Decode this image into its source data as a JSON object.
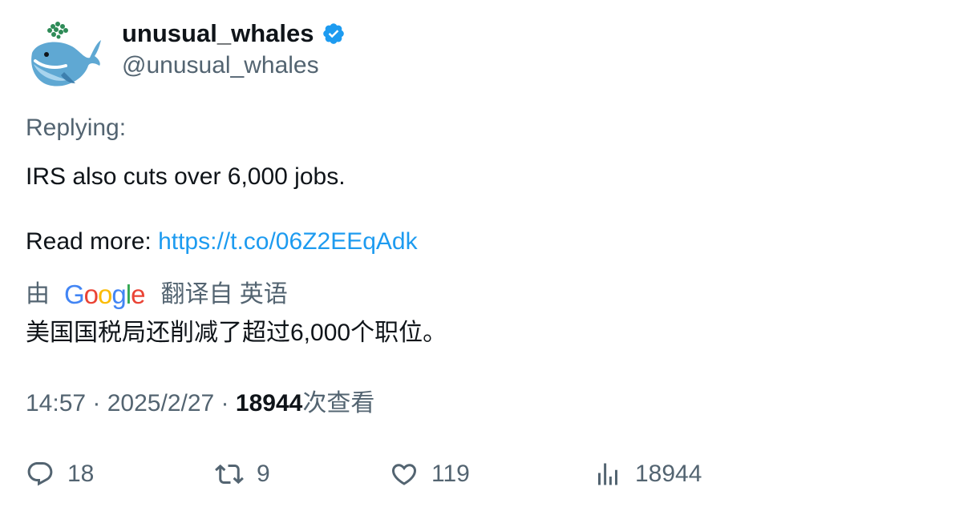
{
  "author": {
    "display_name": "unusual_whales",
    "handle": "@unusual_whales",
    "verified_icon": "verified-badge-icon",
    "avatar_icon": "whale-avatar-icon"
  },
  "tweet": {
    "replying_label": "Replying:",
    "line1": "IRS also cuts over 6,000 jobs.",
    "read_more_label": "Read more: ",
    "link_text": "https://t.co/06Z2EEqAdk"
  },
  "translation": {
    "by_label": "由",
    "provider": "Google",
    "from_label": "翻译自 英语",
    "translated_text": "美国国税局还削减了超过6,000个职位。"
  },
  "meta": {
    "time": "14:57",
    "separator": " · ",
    "date": "2025/2/27",
    "views_count": "18944",
    "views_label": "次查看"
  },
  "actions": {
    "replies": "18",
    "retweets": "9",
    "likes": "119",
    "views": "18944"
  },
  "colors": {
    "link": "#1d9bf0",
    "secondary_text": "#536471",
    "primary_text": "#0f1419",
    "verified": "#1d9bf0"
  }
}
